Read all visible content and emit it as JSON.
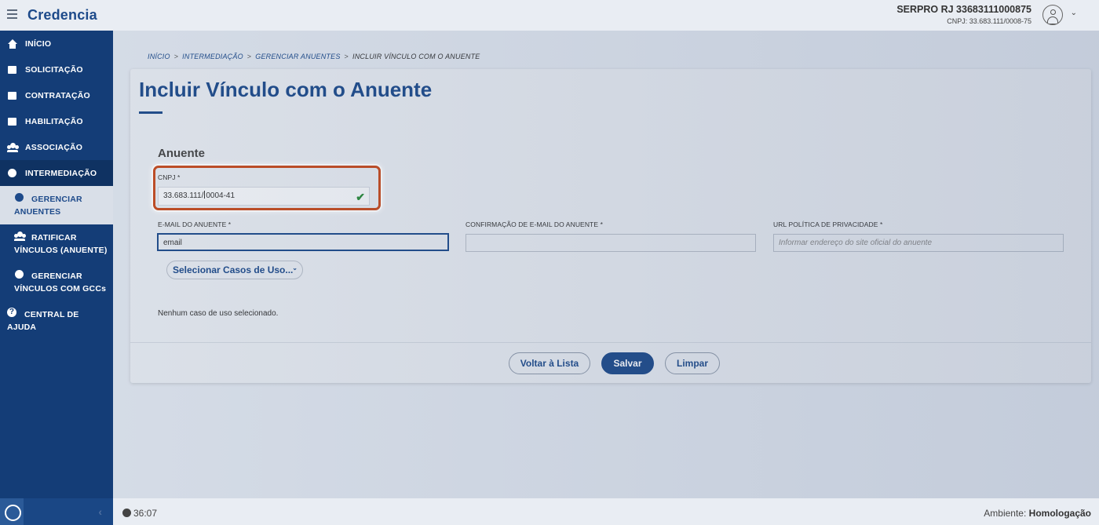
{
  "app": {
    "brand": "Credencia",
    "user_name": "SERPRO RJ 33683111000875",
    "user_cnpj": "CNPJ: 33.683.111/0008-75"
  },
  "sidebar": {
    "items": [
      {
        "label": "INÍCIO",
        "icon": "home-icon"
      },
      {
        "label": "SOLICITAÇÃO",
        "icon": "edit-icon"
      },
      {
        "label": "CONTRATAÇÃO",
        "icon": "handshake-icon"
      },
      {
        "label": "HABILITAÇÃO",
        "icon": "id-card-icon"
      },
      {
        "label": "ASSOCIAÇÃO",
        "icon": "users-icon"
      },
      {
        "label": "INTERMEDIAÇÃO",
        "icon": "user-hand-icon"
      }
    ],
    "sub_items": [
      {
        "line1": "GERENCIAR",
        "line2": "ANUENTES",
        "icon": "user-gear-icon"
      },
      {
        "line1": "RATIFICAR",
        "line2": "VÍNCULOS (ANUENTE)",
        "icon": "user-check-icon"
      },
      {
        "line1": "GERENCIAR",
        "line2": "VÍNCULOS COM GCCs",
        "icon": "link-icon"
      }
    ],
    "help": {
      "line1": "CENTRAL DE",
      "line2": "AJUDA",
      "icon": "help-icon"
    }
  },
  "breadcrumb": [
    "INÍCIO",
    "INTERMEDIAÇÃO",
    "GERENCIAR ANUENTES",
    "INCLUIR VÍNCULO COM O ANUENTE"
  ],
  "page": {
    "title": "Incluir Vínculo com o Anuente",
    "section": "Anuente"
  },
  "form": {
    "cnpj_label": "CNPJ *",
    "cnpj_value_a": "33.683.111/",
    "cnpj_value_b": "0004-41",
    "email_label": "E-MAIL DO ANUENTE *",
    "email_value": "email",
    "email_confirm_label": "CONFIRMAÇÃO DE E-MAIL DO ANUENTE *",
    "email_confirm_value": "",
    "url_label": "URL POLÍTICA DE PRIVACIDADE *",
    "url_placeholder": "Informar endereço do site oficial do anuente",
    "select_label": "Selecionar Casos de Uso...",
    "no_case": "Nenhum caso de uso selecionado."
  },
  "buttons": {
    "back": "Voltar à Lista",
    "save": "Salvar",
    "clear": "Limpar"
  },
  "footer": {
    "timer": "36:07",
    "env_label": "Ambiente:",
    "env_value": "Homologação"
  },
  "colors": {
    "primary": "#1d4a8a",
    "sidebar": "#143d77",
    "highlight": "#c54a1e",
    "success": "#2a8a3a"
  }
}
